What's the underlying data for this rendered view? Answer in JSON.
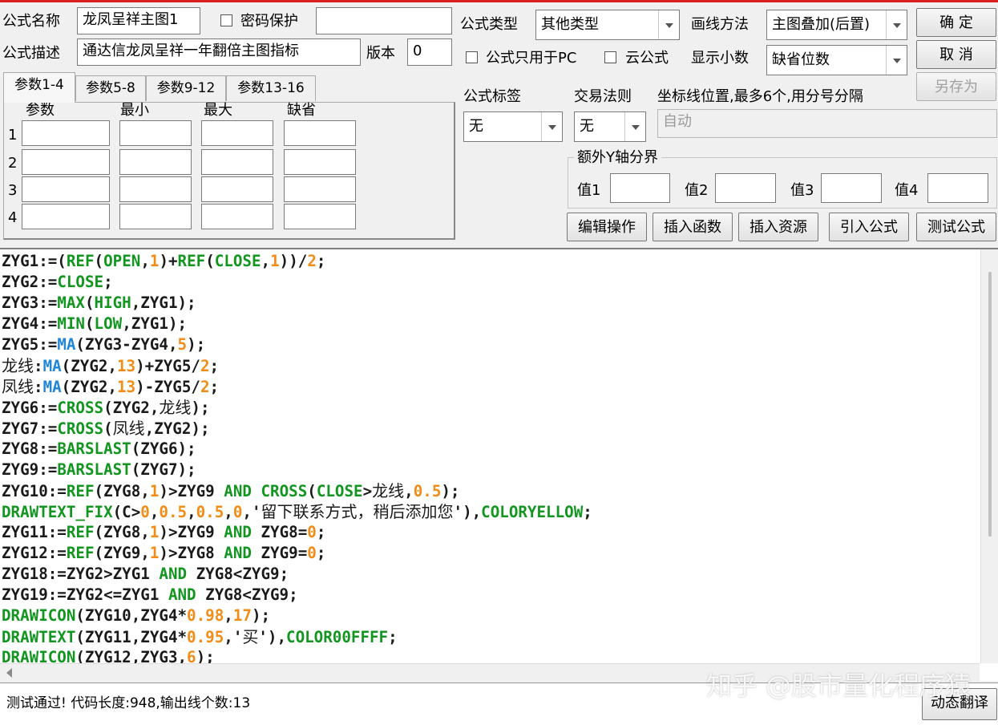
{
  "formula": {
    "name_label": "公式名称",
    "name_value": "龙凤呈祥主图1",
    "password_label": "密码保护",
    "desc_label": "公式描述",
    "desc_value": "通达信龙凤呈祥一年翻倍主图指标",
    "version_label": "版本",
    "version_value": "0",
    "type_label": "公式类型",
    "type_value": "其他类型",
    "draw_method_label": "画线方法",
    "draw_method_value": "主图叠加(后置)",
    "pc_only_label": "公式只用于PC",
    "cloud_label": "云公式",
    "decimals_label": "显示小数",
    "decimals_value": "缺省位数",
    "tag_label": "公式标签",
    "tag_value": "无",
    "trade_rule_label": "交易法则",
    "trade_rule_value": "无",
    "coord_label": "坐标线位置,最多6个,用分号分隔",
    "coord_placeholder": "自动",
    "extra_y_label": "额外Y轴分界",
    "y_values": [
      "值1",
      "值2",
      "值3",
      "值4"
    ]
  },
  "buttons": {
    "ok": "确  定",
    "cancel": "取  消",
    "save_as": "另存为",
    "edit_ops": "编辑操作",
    "insert_func": "插入函数",
    "insert_res": "插入资源",
    "import_formula": "引入公式",
    "test_formula": "测试公式",
    "dynamic_translate": "动态翻译"
  },
  "tabs": [
    "参数1-4",
    "参数5-8",
    "参数9-12",
    "参数13-16"
  ],
  "params": {
    "headers": [
      "参数",
      "最小",
      "最大",
      "缺省"
    ],
    "rows": [
      "1",
      "2",
      "3",
      "4"
    ]
  },
  "code_lines": [
    [
      [
        "ZYG1:=(",
        ""
      ],
      [
        "REF",
        "g"
      ],
      [
        "(",
        ""
      ],
      [
        "OPEN",
        "g"
      ],
      [
        ",",
        ""
      ],
      [
        "1",
        "n"
      ],
      [
        ")+",
        ""
      ],
      [
        "REF",
        "g"
      ],
      [
        "(",
        ""
      ],
      [
        "CLOSE",
        "g"
      ],
      [
        ",",
        ""
      ],
      [
        "1",
        "n"
      ],
      [
        "))/",
        ""
      ],
      [
        "2",
        "n"
      ],
      [
        ";",
        ""
      ]
    ],
    [
      [
        "ZYG2:=",
        ""
      ],
      [
        "CLOSE",
        "g"
      ],
      [
        ";",
        ""
      ]
    ],
    [
      [
        "ZYG3:=",
        ""
      ],
      [
        "MAX",
        "g"
      ],
      [
        "(",
        ""
      ],
      [
        "HIGH",
        "g"
      ],
      [
        ",ZYG1);",
        ""
      ]
    ],
    [
      [
        "ZYG4:=",
        ""
      ],
      [
        "MIN",
        "g"
      ],
      [
        "(",
        ""
      ],
      [
        "LOW",
        "g"
      ],
      [
        ",ZYG1);",
        ""
      ]
    ],
    [
      [
        "ZYG5:=",
        ""
      ],
      [
        "MA",
        "b"
      ],
      [
        "(ZYG3-ZYG4,",
        ""
      ],
      [
        "5",
        "n"
      ],
      [
        ");",
        ""
      ]
    ],
    [
      [
        "龙线",
        "c"
      ],
      [
        ":",
        ""
      ],
      [
        "MA",
        "b"
      ],
      [
        "(ZYG2,",
        ""
      ],
      [
        "13",
        "n"
      ],
      [
        ")+ZYG5/",
        ""
      ],
      [
        "2",
        "n"
      ],
      [
        ";",
        ""
      ]
    ],
    [
      [
        "凤线",
        "c"
      ],
      [
        ":",
        ""
      ],
      [
        "MA",
        "b"
      ],
      [
        "(ZYG2,",
        ""
      ],
      [
        "13",
        "n"
      ],
      [
        ")-ZYG5/",
        ""
      ],
      [
        "2",
        "n"
      ],
      [
        ";",
        ""
      ]
    ],
    [
      [
        "ZYG6:=",
        ""
      ],
      [
        "CROSS",
        "g"
      ],
      [
        "(ZYG2,",
        ""
      ],
      [
        "龙线",
        "c"
      ],
      [
        ");",
        ""
      ]
    ],
    [
      [
        "ZYG7:=",
        ""
      ],
      [
        "CROSS",
        "g"
      ],
      [
        "(",
        ""
      ],
      [
        "凤线",
        "c"
      ],
      [
        ",ZYG2);",
        ""
      ]
    ],
    [
      [
        "ZYG8:=",
        ""
      ],
      [
        "BARSLAST",
        "g"
      ],
      [
        "(ZYG6);",
        ""
      ]
    ],
    [
      [
        "ZYG9:=",
        ""
      ],
      [
        "BARSLAST",
        "g"
      ],
      [
        "(ZYG7);",
        ""
      ]
    ],
    [
      [
        "ZYG10:=",
        ""
      ],
      [
        "REF",
        "g"
      ],
      [
        "(ZYG8,",
        ""
      ],
      [
        "1",
        "n"
      ],
      [
        ")>ZYG9 ",
        ""
      ],
      [
        "AND",
        "g"
      ],
      [
        " ",
        ""
      ],
      [
        "CROSS",
        "g"
      ],
      [
        "(",
        ""
      ],
      [
        "CLOSE",
        "g"
      ],
      [
        ">",
        ""
      ],
      [
        "龙线",
        "c"
      ],
      [
        ",",
        ""
      ],
      [
        "0.5",
        "n"
      ],
      [
        ");",
        ""
      ]
    ],
    [
      [
        "DRAWTEXT_FIX",
        "g"
      ],
      [
        "(C>",
        ""
      ],
      [
        "0",
        "n"
      ],
      [
        ",",
        ""
      ],
      [
        "0.5",
        "n"
      ],
      [
        ",",
        ""
      ],
      [
        "0.5",
        "n"
      ],
      [
        ",",
        ""
      ],
      [
        "0",
        "n"
      ],
      [
        ",'",
        ""
      ],
      [
        "留下联系方式，稍后添加您",
        "c"
      ],
      [
        "'),",
        ""
      ],
      [
        "COLORYELLOW",
        "g"
      ],
      [
        ";",
        ""
      ]
    ],
    [
      [
        "ZYG11:=",
        ""
      ],
      [
        "REF",
        "g"
      ],
      [
        "(ZYG8,",
        ""
      ],
      [
        "1",
        "n"
      ],
      [
        ")>ZYG9 ",
        ""
      ],
      [
        "AND",
        "g"
      ],
      [
        " ZYG8=",
        ""
      ],
      [
        "0",
        "n"
      ],
      [
        ";",
        ""
      ]
    ],
    [
      [
        "ZYG12:=",
        ""
      ],
      [
        "REF",
        "g"
      ],
      [
        "(ZYG9,",
        ""
      ],
      [
        "1",
        "n"
      ],
      [
        ")>ZYG8 ",
        ""
      ],
      [
        "AND",
        "g"
      ],
      [
        " ZYG9=",
        ""
      ],
      [
        "0",
        "n"
      ],
      [
        ";",
        ""
      ]
    ],
    [
      [
        "ZYG18:=ZYG2>ZYG1 ",
        ""
      ],
      [
        "AND",
        "g"
      ],
      [
        " ZYG8<ZYG9;",
        ""
      ]
    ],
    [
      [
        "ZYG19:=ZYG2<=ZYG1 ",
        ""
      ],
      [
        "AND",
        "g"
      ],
      [
        " ZYG8<ZYG9;",
        ""
      ]
    ],
    [
      [
        "DRAWICON",
        "g"
      ],
      [
        "(ZYG10,ZYG4*",
        ""
      ],
      [
        "0.98",
        "n"
      ],
      [
        ",",
        ""
      ],
      [
        "17",
        "n"
      ],
      [
        ");",
        ""
      ]
    ],
    [
      [
        "DRAWTEXT",
        "g"
      ],
      [
        "(ZYG11,ZYG4*",
        ""
      ],
      [
        "0.95",
        "n"
      ],
      [
        ",'",
        ""
      ],
      [
        "买",
        "c"
      ],
      [
        "'),",
        ""
      ],
      [
        "COLOR00FFFF",
        "g"
      ],
      [
        ";",
        ""
      ]
    ],
    [
      [
        "DRAWICON",
        "g"
      ],
      [
        "(ZYG12,ZYG3,",
        ""
      ],
      [
        "6",
        "n"
      ],
      [
        ");",
        ""
      ]
    ]
  ],
  "status": {
    "message": "测试通过! 代码长度:948,输出线个数:13"
  },
  "watermark": "知乎 @股市量化程序猿",
  "colors": {
    "function_green": "#129620",
    "function_blue": "#2086d8",
    "number_orange": "#f28c16"
  }
}
